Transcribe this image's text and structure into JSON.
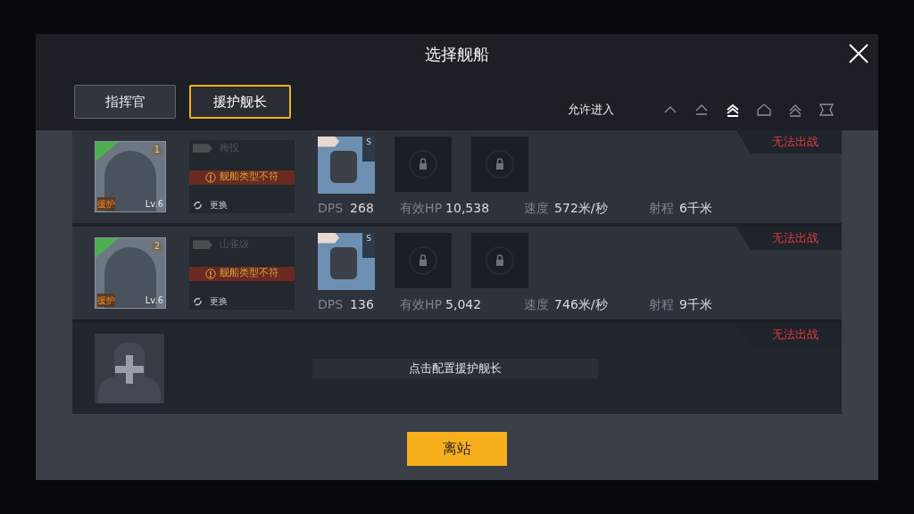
{
  "window": {
    "title": "选择舰船"
  },
  "tabs": [
    {
      "label": "指挥官",
      "selected": false
    },
    {
      "label": "援护舰长",
      "selected": true
    }
  ],
  "filter": {
    "label": "允许进入",
    "tiers": [
      {
        "selected": false
      },
      {
        "selected": false
      },
      {
        "selected": true
      },
      {
        "selected": false
      },
      {
        "selected": false
      },
      {
        "selected": false
      }
    ]
  },
  "rows": [
    {
      "kind": "crew",
      "status": "无法出战",
      "badge": "1",
      "role": "援护",
      "level": "Lv.6",
      "ship_name": "梅投",
      "warning": "舰船类型不符",
      "swap": "更换",
      "weapon_grade": "S",
      "dps_label": "DPS",
      "dps": "268",
      "hp_label": "有效HP",
      "hp": "10,538",
      "speed_label": "速度",
      "speed": "572米/秒",
      "range_label": "射程",
      "range": "6千米"
    },
    {
      "kind": "crew",
      "status": "无法出战",
      "badge": "2",
      "role": "援护",
      "level": "Lv.6",
      "ship_name": "山雀级",
      "warning": "舰船类型不符",
      "swap": "更换",
      "weapon_grade": "S",
      "dps_label": "DPS",
      "dps": "136",
      "hp_label": "有效HP",
      "hp": "5,042",
      "speed_label": "速度",
      "speed": "746米/秒",
      "range_label": "射程",
      "range": "9千米"
    },
    {
      "kind": "empty",
      "status": "无法出战",
      "prompt": "点击配置援护舰长"
    }
  ],
  "footer": {
    "button": "离站"
  }
}
